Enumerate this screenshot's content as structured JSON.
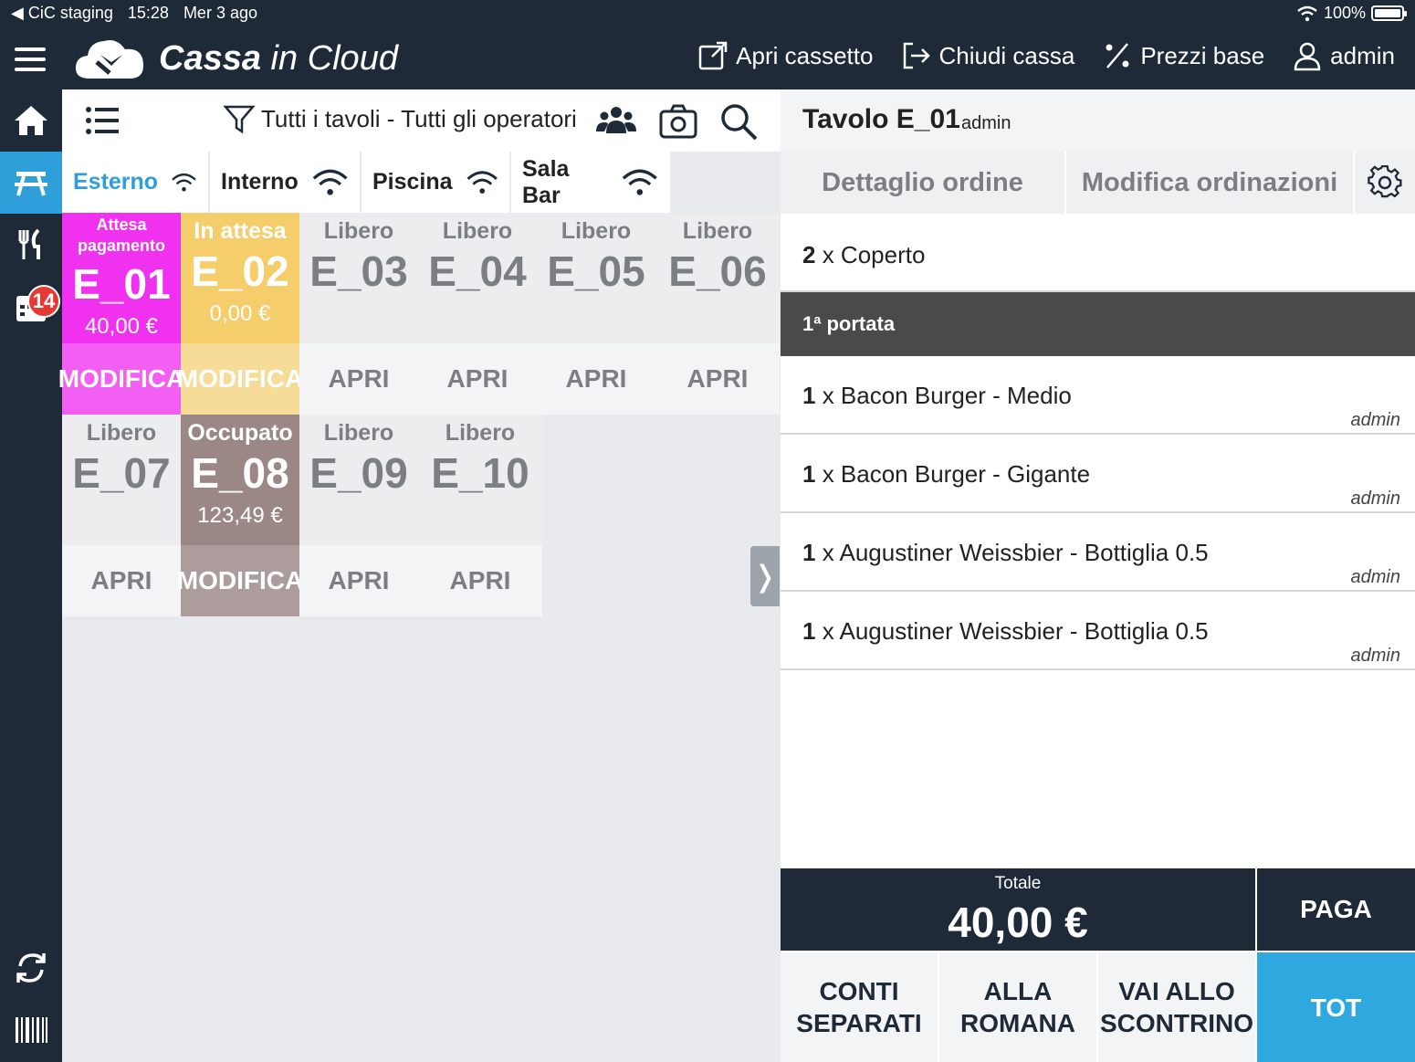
{
  "status_bar": {
    "back_app": "◀ CiC staging",
    "time": "15:28",
    "date": "Mer 3 ago",
    "battery": "100%"
  },
  "header": {
    "logo_bold": "Cassa",
    "logo_rest": " in Cloud",
    "actions": [
      "Apri cassetto",
      "Chiudi cassa",
      "Prezzi base",
      "admin"
    ]
  },
  "sidebar": {
    "badge_count": "14"
  },
  "toolbar": {
    "filter_label": "Tutti i tavoli - Tutti gli operatori"
  },
  "rooms": [
    "Esterno",
    "Interno",
    "Piscina",
    "Sala Bar"
  ],
  "tables": [
    {
      "status": "Attesa pagamento",
      "name": "E_01",
      "amount": "40,00 €",
      "action": "MODIFICA"
    },
    {
      "status": "In attesa",
      "name": "E_02",
      "amount": "0,00 €",
      "action": "MODIFICA"
    },
    {
      "status": "Libero",
      "name": "E_03",
      "amount": "",
      "action": "APRI"
    },
    {
      "status": "Libero",
      "name": "E_04",
      "amount": "",
      "action": "APRI"
    },
    {
      "status": "Libero",
      "name": "E_05",
      "amount": "",
      "action": "APRI"
    },
    {
      "status": "Libero",
      "name": "E_06",
      "amount": "",
      "action": "APRI"
    },
    {
      "status": "Libero",
      "name": "E_07",
      "amount": "",
      "action": "APRI"
    },
    {
      "status": "Occupato",
      "name": "E_08",
      "amount": "123,49 €",
      "action": "MODIFICA"
    },
    {
      "status": "Libero",
      "name": "E_09",
      "amount": "",
      "action": "APRI"
    },
    {
      "status": "Libero",
      "name": "E_10",
      "amount": "",
      "action": "APRI"
    }
  ],
  "order": {
    "title": "Tavolo E_01",
    "operator": "admin",
    "tabs": [
      "Dettaglio ordine",
      "Modifica ordinazioni"
    ],
    "cover": {
      "qty": "2",
      "text": " x Coperto"
    },
    "course": "1ª portata",
    "items": [
      {
        "qty": "1",
        "text": " x Bacon Burger - Medio",
        "op": "admin"
      },
      {
        "qty": "1",
        "text": " x Bacon Burger - Gigante",
        "op": "admin"
      },
      {
        "qty": "1",
        "text": " x Augustiner Weissbier - Bottiglia 0.5",
        "op": "admin"
      },
      {
        "qty": "1",
        "text": " x Augustiner Weissbier - Bottiglia 0.5",
        "op": "admin"
      }
    ],
    "total_label": "Totale",
    "total_value": "40,00 €",
    "pay": "PAGA",
    "buttons": [
      {
        "line1": "CONTI",
        "line2": "SEPARATI"
      },
      {
        "line1": "ALLA",
        "line2": "ROMANA"
      },
      {
        "line1": "VAI ALLO",
        "line2": "SCONTRINO"
      },
      {
        "line1": "TOT",
        "line2": ""
      }
    ]
  },
  "colors": {
    "accent": "#2e9fd9",
    "dark": "#1e2a38",
    "wait_pay": "#f032f0",
    "waiting": "#f5cd6b",
    "busy": "#9c8787"
  }
}
